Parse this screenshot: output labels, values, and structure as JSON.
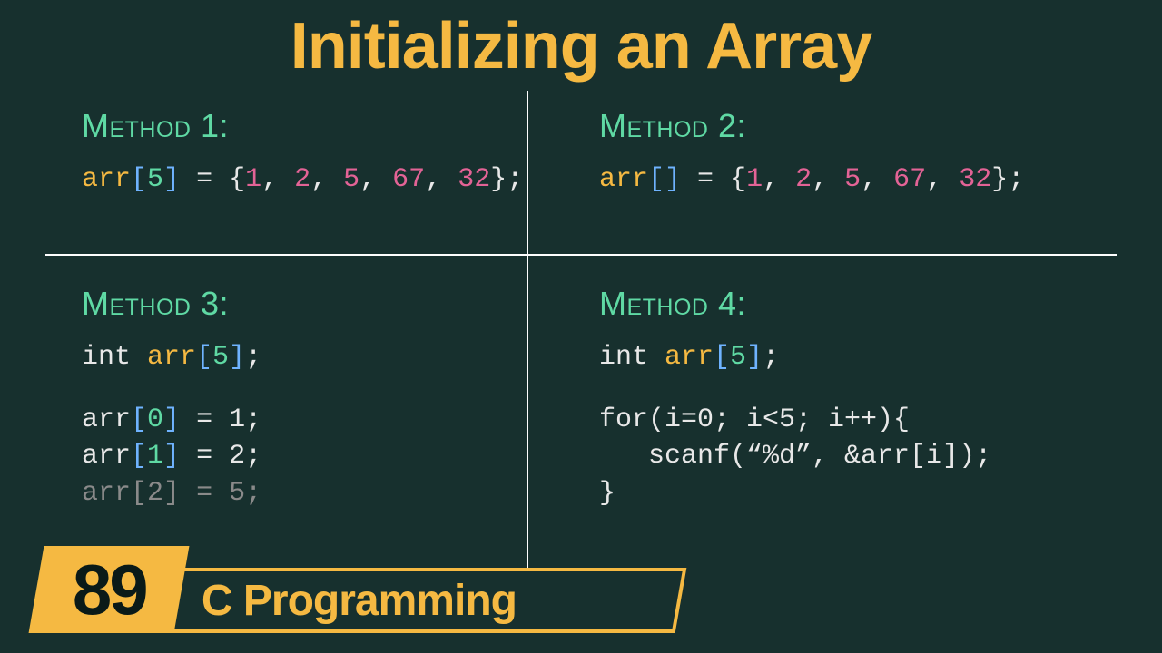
{
  "title": "Initializing an Array",
  "quadrants": {
    "m1": {
      "label": "Method 1:"
    },
    "m2": {
      "label": "Method 2:"
    },
    "m3": {
      "label": "Method 3:"
    },
    "m4": {
      "label": "Method 4:"
    }
  },
  "code": {
    "m1": {
      "arr": "arr",
      "lb": "[",
      "idx": "5",
      "rb": "]",
      "eq": " = {",
      "v1": "1",
      "c1": ", ",
      "v2": "2",
      "c2": ", ",
      "v3": "5",
      "c3": ", ",
      "v4": "67",
      "c4": ", ",
      "v5": "32",
      "end": "};"
    },
    "m2": {
      "arr": "arr",
      "lb": "[",
      "rb": "]",
      "eq": " = {",
      "v1": "1",
      "c1": ", ",
      "v2": "2",
      "c2": ", ",
      "v3": "5",
      "c3": ", ",
      "v4": "67",
      "c4": ", ",
      "v5": "32",
      "end": "};"
    },
    "m3": {
      "decl_kw": "int ",
      "decl_arr": "arr",
      "decl_lb": "[",
      "decl_idx": "5",
      "decl_rb": "]",
      "decl_end": ";",
      "l1_arr": "arr",
      "l1_lb": "[",
      "l1_idx": "0",
      "l1_rb": "]",
      "l1_rest": " = 1;",
      "l2_arr": "arr",
      "l2_lb": "[",
      "l2_idx": "1",
      "l2_rb": "]",
      "l2_rest": " = 2;",
      "l3_arr": "arr",
      "l3_lb": "[",
      "l3_idx": "2",
      "l3_rb": "]",
      "l3_rest": " = 5;"
    },
    "m4": {
      "decl_kw": "int ",
      "decl_arr": "arr",
      "decl_lb": "[",
      "decl_idx": "5",
      "decl_rb": "]",
      "decl_end": ";",
      "for": "for(i=0; i<5; i++){",
      "scanf": "   scanf(“%d”, &arr[i]);",
      "close": "}"
    }
  },
  "badge": {
    "number": "89",
    "subject": "C Programming"
  }
}
